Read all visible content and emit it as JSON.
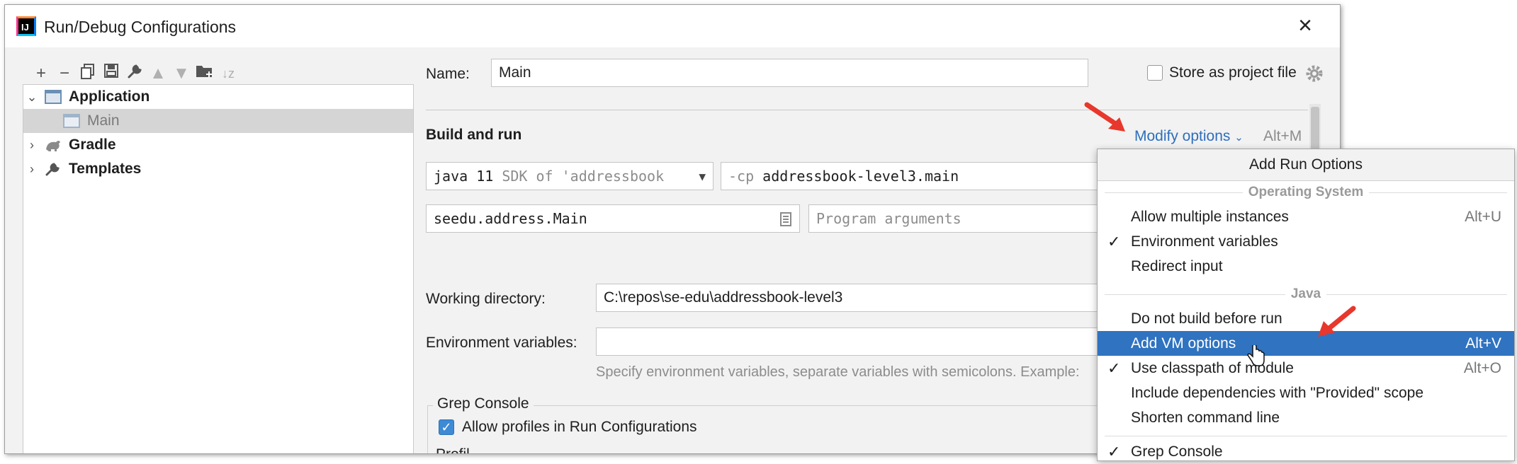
{
  "window": {
    "title": "Run/Debug Configurations",
    "logo_text": "IJ"
  },
  "toolbar": {
    "icons": [
      "plus-icon",
      "minus-icon",
      "copy-icon",
      "save-icon",
      "wrench-icon",
      "arrow-up-icon",
      "arrow-down-icon",
      "new-folder-icon",
      "sort-icon"
    ]
  },
  "tree": {
    "items": [
      {
        "label": "Application",
        "bold": true,
        "expanded": true
      },
      {
        "label": "Main",
        "selected": true
      },
      {
        "label": "Gradle",
        "bold": true,
        "expanded": false
      },
      {
        "label": "Templates",
        "bold": true,
        "expanded": false
      }
    ]
  },
  "form": {
    "name_label": "Name:",
    "name_value": "Main",
    "store_label": "Store as project file",
    "store_checked": false,
    "section_build": "Build and run",
    "modify_options": "Modify options",
    "modify_shortcut": "Alt+M",
    "jdk_prefix": "java 11",
    "jdk_suffix": "SDK of 'addressbook",
    "cp_prefix": "-cp",
    "cp_value": "addressbook-level3.main",
    "main_class": "seedu.address.Main",
    "program_args_placeholder": "Program arguments",
    "workdir_label": "Working directory:",
    "workdir_value": "C:\\repos\\se-edu\\addressbook-level3",
    "env_label": "Environment variables:",
    "env_hint": "Specify environment variables, separate variables with semicolons. Example:",
    "grep_group": "Grep Console",
    "grep_checkbox_label": "Allow profiles in Run Configurations",
    "grep_checked": true,
    "partial_label": "Profil"
  },
  "popup": {
    "title": "Add Run Options",
    "groups": [
      {
        "header": "Operating System",
        "items": [
          {
            "label": "Allow multiple instances",
            "shortcut": "Alt+U",
            "checked": false
          },
          {
            "label": "Environment variables",
            "shortcut": "",
            "checked": true
          },
          {
            "label": "Redirect input",
            "shortcut": "",
            "checked": false
          }
        ]
      },
      {
        "header": "Java",
        "items": [
          {
            "label": "Do not build before run",
            "shortcut": "",
            "checked": false
          },
          {
            "label": "Add VM options",
            "shortcut": "Alt+V",
            "checked": false,
            "highlighted": true
          },
          {
            "label": "Use classpath of module",
            "shortcut": "Alt+O",
            "checked": true
          },
          {
            "label": "Include dependencies with \"Provided\" scope",
            "shortcut": "",
            "checked": false
          },
          {
            "label": "Shorten command line",
            "shortcut": "",
            "checked": false
          }
        ]
      }
    ],
    "cut_item": "Grep Console"
  },
  "colors": {
    "accent": "#2f73c1",
    "link": "#2d6fbd",
    "annotation_arrow": "#e8372c"
  }
}
